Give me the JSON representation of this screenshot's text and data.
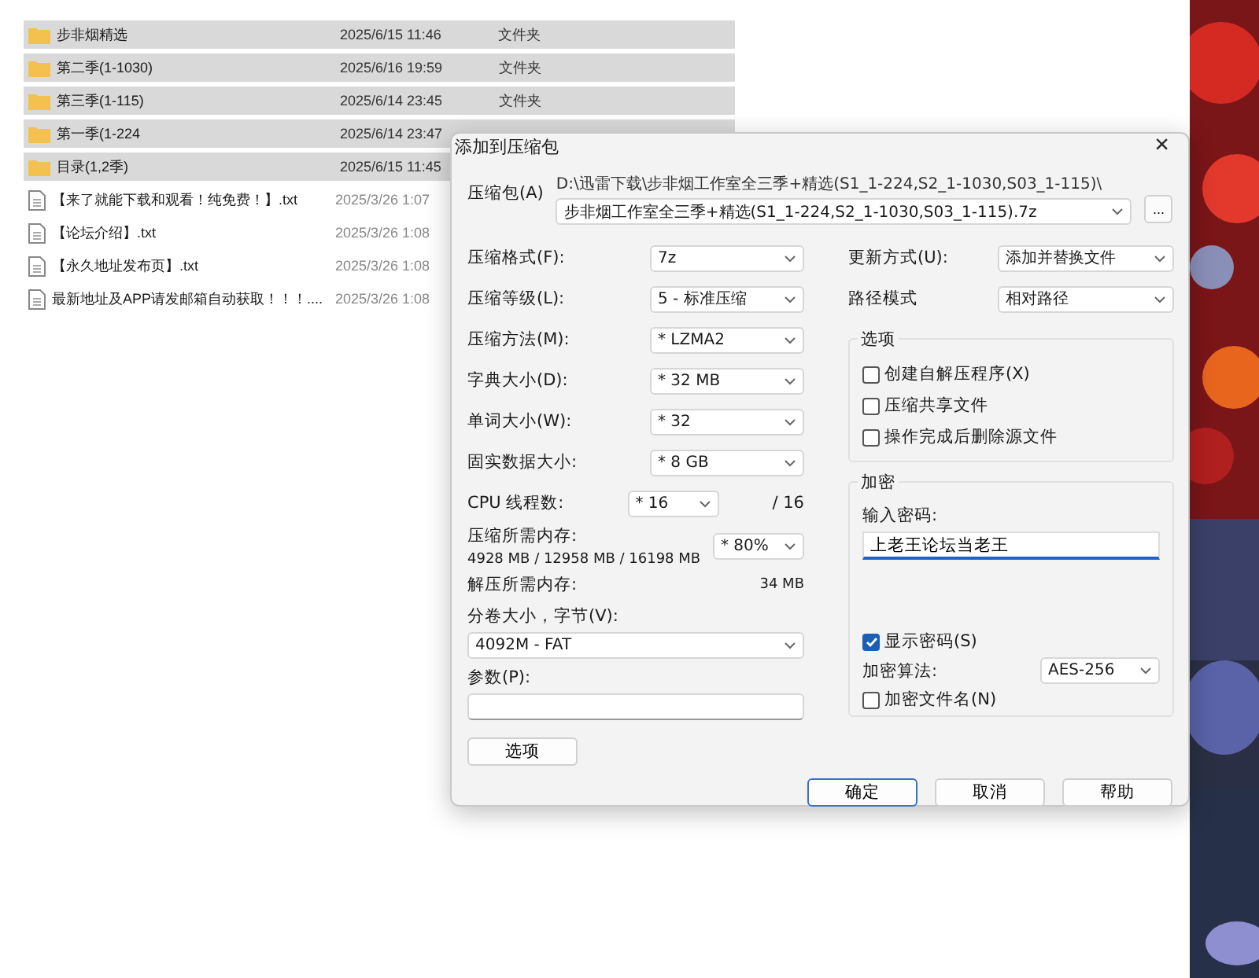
{
  "file_list": {
    "rows": [
      {
        "kind": "folder",
        "name": "步非烟精选",
        "modified": "2025/6/15 11:46",
        "type": "文件夹",
        "selected": true
      },
      {
        "kind": "folder",
        "name": "第二季(1-1030)",
        "modified": "2025/6/16 19:59",
        "type": "文件夹",
        "selected": true
      },
      {
        "kind": "folder",
        "name": "第三季(1-115)",
        "modified": "2025/6/14 23:45",
        "type": "文件夹",
        "selected": true
      },
      {
        "kind": "folder",
        "name": "第一季(1-224",
        "modified": "2025/6/14 23:47",
        "type": "",
        "selected": true
      },
      {
        "kind": "folder",
        "name": "目录(1,2季)",
        "modified": "2025/6/15 11:45",
        "type": "",
        "selected": true
      },
      {
        "kind": "file",
        "name": "【来了就能下载和观看！纯免费！】.txt",
        "modified": "2025/3/26 1:07",
        "selected": false
      },
      {
        "kind": "file",
        "name": "【论坛介绍】.txt",
        "modified": "2025/3/26 1:08",
        "selected": false
      },
      {
        "kind": "file",
        "name": "【永久地址发布页】.txt",
        "modified": "2025/3/26 1:08",
        "selected": false
      },
      {
        "kind": "file",
        "name": "最新地址及APP请发邮箱自动获取！！！....",
        "modified": "2025/3/26 1:08",
        "selected": false
      }
    ]
  },
  "dialog": {
    "title": "添加到压缩包",
    "close": "×",
    "archive": {
      "label": "压缩包(A)",
      "path": "D:\\迅雷下载\\步非烟工作室全三季+精选(S1_1-224,S2_1-1030,S03_1-115)\\",
      "value": "步非烟工作室全三季+精选(S1_1-224,S2_1-1030,S03_1-115).7z",
      "browse": "..."
    },
    "left_fields": [
      {
        "kind": "select",
        "label": "压缩格式(F):",
        "value": "7z"
      },
      {
        "kind": "select",
        "label": "压缩等级(L):",
        "value": "5 - 标准压缩"
      },
      {
        "kind": "select",
        "label": "压缩方法(M):",
        "value": "* LZMA2"
      },
      {
        "kind": "select",
        "label": "字典大小(D):",
        "value": "* 32 MB"
      },
      {
        "kind": "select",
        "label": "单词大小(W):",
        "value": "* 32"
      },
      {
        "kind": "select",
        "label": "固实数据大小:",
        "value": "* 8 GB"
      },
      {
        "kind": "select_suffix",
        "label": "CPU 线程数:",
        "value": "* 16",
        "suffix": "/ 16"
      },
      {
        "kind": "memory",
        "label": "压缩所需内存:",
        "detail": "4928 MB / 12958 MB / 16198 MB",
        "value": "* 80%"
      },
      {
        "kind": "reading",
        "label": "解压所需内存:",
        "value": "34 MB"
      },
      {
        "kind": "wide_select",
        "label": "分卷大小，字节(V):",
        "value": "4092M - FAT"
      },
      {
        "kind": "wide_input",
        "label": "参数(P):"
      }
    ],
    "options_button": "选项",
    "right_fields": [
      {
        "label": "更新方式(U):",
        "value": "添加并替换文件"
      },
      {
        "label": "路径模式",
        "value": "相对路径"
      }
    ],
    "options_group": {
      "title": "选项",
      "items": [
        {
          "label": "创建自解压程序(X)",
          "checked": false
        },
        {
          "label": "压缩共享文件",
          "checked": false
        },
        {
          "label": "操作完成后删除源文件",
          "checked": false
        }
      ]
    },
    "encryption": {
      "title": "加密",
      "password_label": "输入密码:",
      "password": "上老王论坛当老王",
      "show_password": {
        "label": "显示密码(S)",
        "checked": true
      },
      "method": {
        "label": "加密算法:",
        "value": "AES-256"
      },
      "encrypt_names": {
        "label": "加密文件名(N)",
        "checked": false
      }
    },
    "buttons": [
      {
        "label": "确定",
        "default": true
      },
      {
        "label": "取消",
        "default": false
      },
      {
        "label": "帮助",
        "default": false
      }
    ]
  }
}
